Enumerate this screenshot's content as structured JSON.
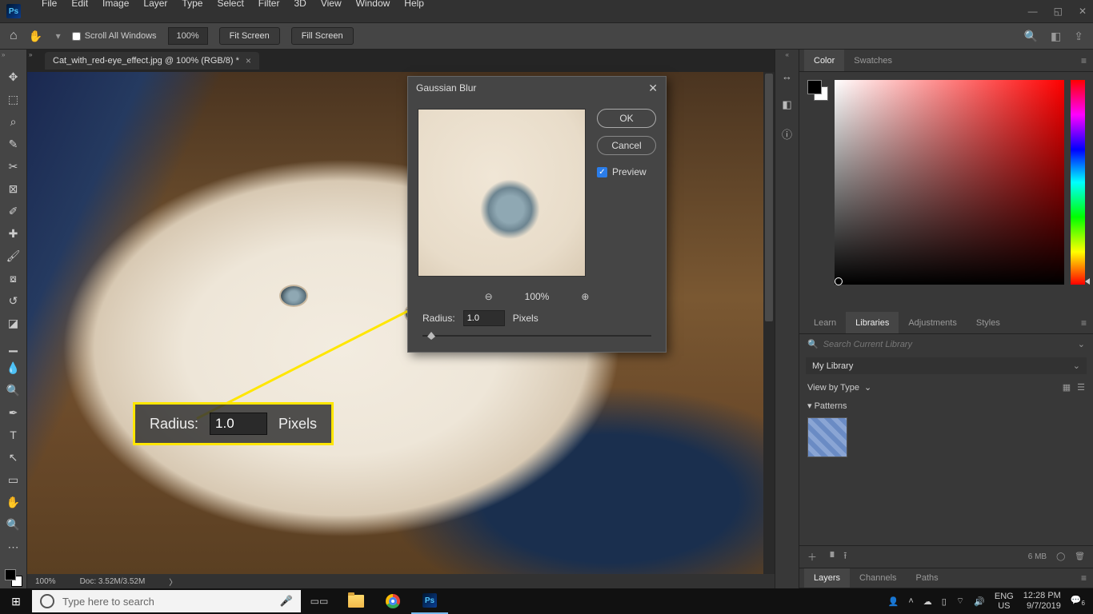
{
  "app": {
    "logo": "Ps"
  },
  "menu": [
    "File",
    "Edit",
    "Image",
    "Layer",
    "Type",
    "Select",
    "Filter",
    "3D",
    "View",
    "Window",
    "Help"
  ],
  "options": {
    "scroll_all": "Scroll All Windows",
    "zoom": "100%",
    "fit": "Fit Screen",
    "fill": "Fill Screen"
  },
  "document": {
    "tab_title": "Cat_with_red-eye_effect.jpg @ 100% (RGB/8) *",
    "zoom": "100%",
    "doc_size": "Doc: 3.52M/3.52M"
  },
  "dialog": {
    "title": "Gaussian Blur",
    "ok": "OK",
    "cancel": "Cancel",
    "preview": "Preview",
    "zoom": "100%",
    "radius_label": "Radius:",
    "radius_value": "1.0",
    "radius_unit": "Pixels"
  },
  "annotation": {
    "radius_label": "Radius:",
    "radius_value": "1.0",
    "radius_unit": "Pixels"
  },
  "panels": {
    "color": {
      "tab_color": "Color",
      "tab_swatches": "Swatches"
    },
    "libraries": {
      "tab_learn": "Learn",
      "tab_libraries": "Libraries",
      "tab_adjustments": "Adjustments",
      "tab_styles": "Styles",
      "search_placeholder": "Search Current Library",
      "library_name": "My Library",
      "view_label": "View by Type",
      "section": "▾ Patterns",
      "footer_size": "6 MB"
    },
    "layers": {
      "tab_layers": "Layers",
      "tab_channels": "Channels",
      "tab_paths": "Paths"
    }
  },
  "taskbar": {
    "search_placeholder": "Type here to search",
    "lang1": "ENG",
    "lang2": "US",
    "time": "12:28 PM",
    "date": "9/7/2019",
    "notif": "6"
  }
}
